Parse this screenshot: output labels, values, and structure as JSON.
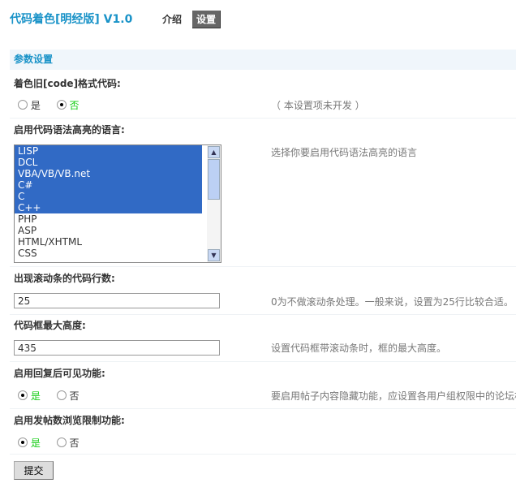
{
  "header": {
    "title": "代码着色[明经版] V1.0",
    "tabs": [
      {
        "label": "介绍",
        "active": false
      },
      {
        "label": "设置",
        "active": true
      }
    ]
  },
  "section_title": "参数设置",
  "settings": {
    "old_code": {
      "label": "着色旧[code]格式代码:",
      "options": [
        "是",
        "否"
      ],
      "selected": "否",
      "note": "（ 本设置项未开发 ）"
    },
    "languages": {
      "label": "启用代码语法高亮的语言:",
      "items": [
        {
          "name": "LISP",
          "selected": true
        },
        {
          "name": "DCL",
          "selected": true
        },
        {
          "name": "VBA/VB/VB.net",
          "selected": true
        },
        {
          "name": "C#",
          "selected": true
        },
        {
          "name": "C",
          "selected": true
        },
        {
          "name": "C++",
          "selected": true
        },
        {
          "name": "PHP",
          "selected": false
        },
        {
          "name": "ASP",
          "selected": false
        },
        {
          "name": "HTML/XHTML",
          "selected": false
        },
        {
          "name": "CSS",
          "selected": false
        }
      ],
      "note": "选择你要启用代码语法高亮的语言"
    },
    "scroll_lines": {
      "label": "出现滚动条的代码行数:",
      "value": "25",
      "note": "0为不做滚动条处理。一般来说，设置为25行比较合适。"
    },
    "max_height": {
      "label": "代码框最大高度:",
      "value": "435",
      "note": "设置代码框带滚动条时，框的最大高度。"
    },
    "reply_visible": {
      "label": "启用回复后可见功能:",
      "options": [
        "是",
        "否"
      ],
      "selected": "是",
      "note": "要启用帖子内容隐藏功能，应设置各用户组权限中的论坛相"
    },
    "post_limit": {
      "label": "启用发帖数浏览限制功能:",
      "options": [
        "是",
        "否"
      ],
      "selected": "是"
    }
  },
  "submit_label": "提交",
  "colors": {
    "accent": "#1a93c8",
    "selection": "#316ac5",
    "selected_option": "#11cc11"
  }
}
